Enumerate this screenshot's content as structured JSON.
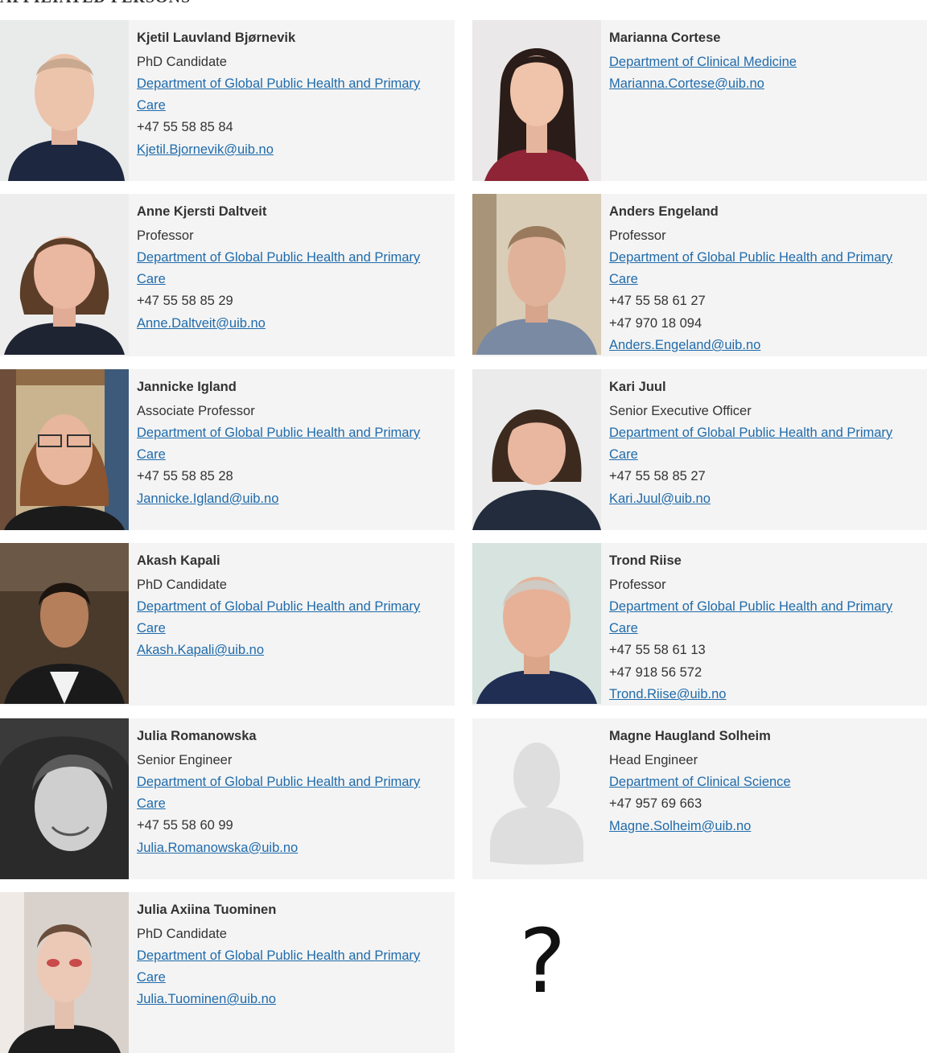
{
  "section": {
    "heading": "AFFILIATED PERSONS"
  },
  "people": [
    {
      "name": "Kjetil Lauvland Bjørnevik",
      "title": "PhD Candidate",
      "department": "Department of Global Public Health and Primary Care",
      "phones": [
        "+47 55 58 85 84"
      ],
      "email": "Kjetil.Bjornevik@uib.no",
      "photo_icon": "portrait-photo"
    },
    {
      "name": "Marianna Cortese",
      "title": "",
      "department": "Department of Clinical Medicine",
      "phones": [],
      "email": "Marianna.Cortese@uib.no",
      "photo_icon": "portrait-photo"
    },
    {
      "name": "Anne Kjersti Daltveit",
      "title": "Professor",
      "department": "Department of Global Public Health and Primary Care",
      "phones": [
        "+47 55 58 85 29"
      ],
      "email": "Anne.Daltveit@uib.no",
      "photo_icon": "portrait-photo"
    },
    {
      "name": "Anders Engeland",
      "title": "Professor",
      "department": "Department of Global Public Health and Primary Care",
      "phones": [
        "+47 55 58 61 27",
        "+47 970 18 094"
      ],
      "email": "Anders.Engeland@uib.no",
      "photo_icon": "portrait-photo"
    },
    {
      "name": "Jannicke Igland",
      "title": "Associate Professor",
      "department": "Department of Global Public Health and Primary Care",
      "phones": [
        "+47 55 58 85 28"
      ],
      "email": "Jannicke.Igland@uib.no",
      "photo_icon": "portrait-photo"
    },
    {
      "name": "Kari Juul",
      "title": "Senior Executive Officer",
      "department": "Department of Global Public Health and Primary Care",
      "phones": [
        "+47 55 58 85 27"
      ],
      "email": "Kari.Juul@uib.no",
      "photo_icon": "portrait-photo"
    },
    {
      "name": "Akash Kapali",
      "title": "PhD Candidate",
      "department": "Department of Global Public Health and Primary Care",
      "phones": [],
      "email": "Akash.Kapali@uib.no",
      "photo_icon": "portrait-photo"
    },
    {
      "name": "Trond Riise",
      "title": "Professor",
      "department": "Department of Global Public Health and Primary Care",
      "phones": [
        "+47 55 58 61 13",
        "+47 918 56 572"
      ],
      "email": "Trond.Riise@uib.no",
      "photo_icon": "portrait-photo"
    },
    {
      "name": "Julia Romanowska",
      "title": "Senior Engineer",
      "department": "Department of Global Public Health and Primary Care",
      "phones": [
        "+47 55 58 60 99"
      ],
      "email": "Julia.Romanowska@uib.no",
      "photo_icon": "portrait-photo"
    },
    {
      "name": "Magne Haugland Solheim",
      "title": "Head Engineer",
      "department": "Department of Clinical Science",
      "phones": [
        "+47 957 69 663"
      ],
      "email": "Magne.Solheim@uib.no",
      "photo_icon": "avatar-placeholder-icon"
    },
    {
      "name": "Julia Axiina Tuominen",
      "title": "PhD Candidate",
      "department": "Department of Global Public Health and Primary Care",
      "phones": [],
      "email": "Julia.Tuominen@uib.no",
      "photo_icon": "portrait-photo"
    }
  ],
  "placeholder_mark": "?",
  "colors": {
    "card_background": "#f4f4f4",
    "link": "#1f6bab",
    "text": "#333333"
  }
}
